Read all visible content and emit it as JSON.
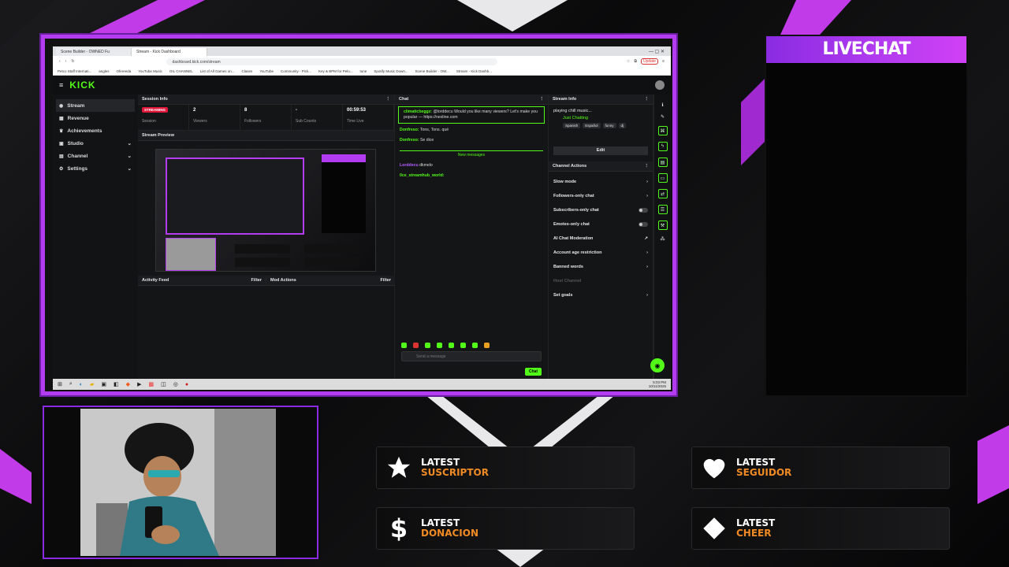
{
  "browser": {
    "tabs": [
      "Scene Builder - OWNED Fu",
      "Stream - Kick Dashboard"
    ],
    "url": "dashboard.kick.com/stream",
    "update_label": "Update",
    "bookmarks": [
      "Petco Staff Internati...",
      "angles",
      "Ofereeda",
      "YouTube Music",
      "OIL CHANNEL",
      "List of All Games on...",
      "Clases",
      "YouTube",
      "Community - Pick...",
      "Key & BPM for Pelo...",
      "tune",
      "Spotify Music Down...",
      "Scene Builder - OW...",
      "Stream - Kick Dashb..."
    ]
  },
  "kick": {
    "logo": "KICK",
    "sidebar": [
      {
        "label": "Stream",
        "icon": "stream-icon"
      },
      {
        "label": "Revenue",
        "icon": "revenue-icon"
      },
      {
        "label": "Achievements",
        "icon": "trophy-icon"
      },
      {
        "label": "Studio",
        "icon": "studio-icon"
      },
      {
        "label": "Channel",
        "icon": "channel-icon"
      },
      {
        "label": "Settings",
        "icon": "gear-icon"
      }
    ],
    "session": {
      "title": "Session Info",
      "status": "STREAMING",
      "stats": [
        {
          "value": "",
          "label": "Session"
        },
        {
          "value": "2",
          "label": "Viewers"
        },
        {
          "value": "8",
          "label": "Followers"
        },
        {
          "value": "-",
          "label": "Sub Counts"
        },
        {
          "value": "00:59:53",
          "label": "Time Live"
        }
      ]
    },
    "preview_title": "Stream Preview",
    "activity_title": "Activity Feed",
    "mod_title": "Mod Actions",
    "filter_label": "Filter",
    "chat": {
      "title": "Chat",
      "messages": [
        {
          "user": "climaticbeggz:",
          "text": "@lorddecu Would you like many viewers? Let's make you popular — https://nexline.com"
        },
        {
          "user": "Donfreso:",
          "text": "Tons, Tons. qué"
        },
        {
          "user": "Donfreso:",
          "text": "Se dice"
        }
      ],
      "divider": "New messages",
      "messages2": [
        {
          "user": "Lorddecu",
          "text": "dkmelo"
        },
        {
          "user": "0ce_streamhub_world:",
          "text": ""
        }
      ],
      "placeholder": "Send a message",
      "send_label": "Chat"
    },
    "stream_info": {
      "title": "Stream Info",
      "stream_title": "playing chill music...",
      "category": "Just Chatting",
      "tags": [
        "Spanish",
        "Español",
        "funny",
        "dj"
      ],
      "edit_label": "Edit"
    },
    "channel_actions": {
      "title": "Channel Actions",
      "rows": [
        {
          "label": "Slow mode",
          "control": "chevron"
        },
        {
          "label": "Followers-only chat",
          "control": "chevron"
        },
        {
          "label": "Subscribers-only chat",
          "control": "toggle"
        },
        {
          "label": "Emotes-only chat",
          "control": "toggle"
        },
        {
          "label": "AI Chat Moderation",
          "control": "external"
        },
        {
          "label": "Account age restriction",
          "control": "chevron"
        },
        {
          "label": "Banned words",
          "control": "chevron"
        },
        {
          "label": "Host Channel",
          "control": "none"
        },
        {
          "label": "Set goals",
          "control": "chevron"
        }
      ]
    },
    "taskbar_time": "5:03 PM",
    "taskbar_date": "10/11/2025"
  },
  "overlay": {
    "livechat_title": "LIVECHAT",
    "alerts": [
      {
        "line1": "LATEST",
        "line2": "SUSCRIPTOR",
        "icon": "star-icon"
      },
      {
        "line1": "LATEST",
        "line2": "SEGUIDOR",
        "icon": "heart-icon"
      },
      {
        "line1": "LATEST",
        "line2": "DONACION",
        "icon": "dollar-icon"
      },
      {
        "line1": "LATEST",
        "line2": "CHEER",
        "icon": "diamond-icon"
      }
    ]
  },
  "colors": {
    "accent_purple": "#b43cf0",
    "kick_green": "#53fc18",
    "alert_orange": "#f08a24",
    "live_red": "#e0173b"
  }
}
